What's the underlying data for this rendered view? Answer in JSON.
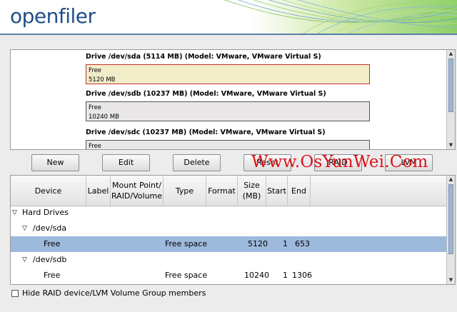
{
  "header": {
    "logo": "openfiler"
  },
  "drives": [
    {
      "title": "Drive /dev/sda (5114 MB) (Model: VMware, VMware Virtual S)",
      "label": "Free",
      "size": "5120 MB",
      "selected": true
    },
    {
      "title": "Drive /dev/sdb (10237 MB) (Model: VMware, VMware Virtual S)",
      "label": "Free",
      "size": "10240 MB",
      "selected": false
    },
    {
      "title": "Drive /dev/sdc (10237 MB) (Model: VMware, VMware Virtual S)",
      "label": "Free",
      "size": "",
      "selected": false
    }
  ],
  "buttons": {
    "new": "New",
    "edit": "Edit",
    "delete": "Delete",
    "reset": "Reset",
    "raid": "RAID",
    "lvm": "LVM"
  },
  "watermark": "Www.OsYunWei.Com",
  "table": {
    "columns": [
      "Device",
      "Label",
      "Mount Point/\nRAID/Volume",
      "Type",
      "Format",
      "Size\n(MB)",
      "Start",
      "End"
    ],
    "rows": [
      {
        "device": "Hard Drives",
        "level": 0,
        "expandable": true,
        "type": "",
        "size": "",
        "start": "",
        "end": "",
        "selected": false
      },
      {
        "device": "/dev/sda",
        "level": 1,
        "expandable": true,
        "type": "",
        "size": "",
        "start": "",
        "end": "",
        "selected": false
      },
      {
        "device": "Free",
        "level": 2,
        "expandable": false,
        "type": "Free space",
        "size": "5120",
        "start": "1",
        "end": "653",
        "selected": true
      },
      {
        "device": "/dev/sdb",
        "level": 1,
        "expandable": true,
        "type": "",
        "size": "",
        "start": "",
        "end": "",
        "selected": false
      },
      {
        "device": "Free",
        "level": 2,
        "expandable": false,
        "type": "Free space",
        "size": "10240",
        "start": "1",
        "end": "1306",
        "selected": false
      }
    ]
  },
  "hide_option": {
    "label": "Hide RAID device/LVM Volume Group members",
    "checked": false
  }
}
